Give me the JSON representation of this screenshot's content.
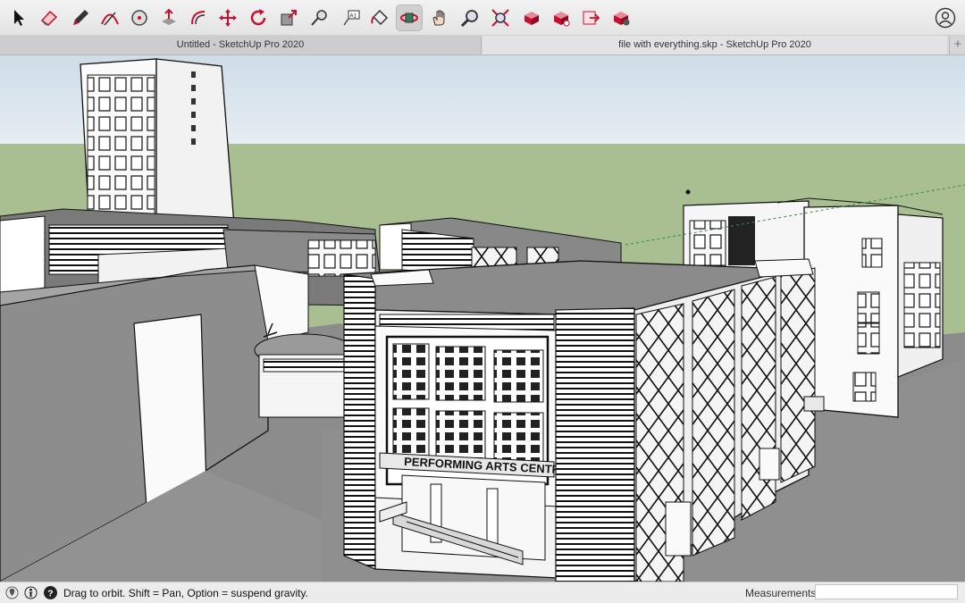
{
  "toolbar": {
    "tools": [
      {
        "name": "select-tool",
        "icon": "arrow-cursor-icon"
      },
      {
        "name": "eraser-tool",
        "icon": "eraser-icon"
      },
      {
        "name": "line-tool",
        "icon": "pencil-icon"
      },
      {
        "name": "arc-tool",
        "icon": "arc-icon"
      },
      {
        "name": "shapes-tool",
        "icon": "circle-shape-icon"
      },
      {
        "name": "push-pull-tool",
        "icon": "push-pull-icon"
      },
      {
        "name": "offset-tool",
        "icon": "offset-icon"
      },
      {
        "name": "move-tool",
        "icon": "move-arrows-icon"
      },
      {
        "name": "rotate-tool",
        "icon": "rotate-icon"
      },
      {
        "name": "scale-tool",
        "icon": "scale-icon"
      },
      {
        "name": "tape-measure-tool",
        "icon": "tape-measure-icon"
      },
      {
        "name": "text-tool",
        "icon": "text-label-icon",
        "label": "A1"
      },
      {
        "name": "paint-bucket-tool",
        "icon": "paint-bucket-icon"
      },
      {
        "name": "orbit-tool",
        "icon": "orbit-icon",
        "active": true
      },
      {
        "name": "pan-tool",
        "icon": "hand-icon"
      },
      {
        "name": "zoom-tool",
        "icon": "magnifier-icon"
      },
      {
        "name": "zoom-extents-tool",
        "icon": "zoom-extents-icon"
      },
      {
        "name": "warehouse-tool",
        "icon": "3d-warehouse-icon"
      },
      {
        "name": "extension-warehouse-tool",
        "icon": "extension-warehouse-icon"
      },
      {
        "name": "layout-tool",
        "icon": "send-to-layout-icon"
      },
      {
        "name": "extension-manager-tool",
        "icon": "extension-manager-icon"
      }
    ],
    "account_icon": "user-account-icon",
    "accent_color": "#c8102e"
  },
  "tabs": [
    {
      "label": "Untitled - SketchUp Pro 2020",
      "active": false
    },
    {
      "label": "file with everything.skp - SketchUp Pro 2020",
      "active": true
    }
  ],
  "tab_add_label": "+",
  "viewport": {
    "sky_color": "#dde8f0",
    "ground_color": "#a9bf91",
    "face_color": "#8f8f8f",
    "sign_text": "PERFORMING ARTS CENTRE"
  },
  "statusbar": {
    "icons": [
      "geo-location-icon",
      "credits-icon",
      "help-icon"
    ],
    "message": "Drag to orbit. Shift = Pan, Option = suspend gravity.",
    "measurements_label": "Measurements",
    "measurements_value": ""
  }
}
